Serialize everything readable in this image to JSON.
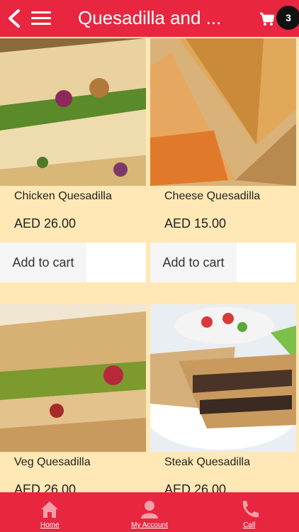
{
  "header": {
    "title": "Quesadilla and ...",
    "cart_count": "3"
  },
  "products": [
    {
      "name": "Chicken Quesadilla",
      "price": "AED 26.00",
      "add_label": "Add to cart"
    },
    {
      "name": "Cheese Quesadilla",
      "price": "AED 15.00",
      "add_label": "Add to cart"
    },
    {
      "name": "Veg Quesadilla",
      "price": "AED 26.00"
    },
    {
      "name": "Steak Quesadilla",
      "price": "AED 26.00"
    }
  ],
  "footer": {
    "home": "Home",
    "account": "My Account",
    "call": "Call"
  },
  "colors": {
    "primary": "#e8263f",
    "background": "#ffe8b5"
  }
}
